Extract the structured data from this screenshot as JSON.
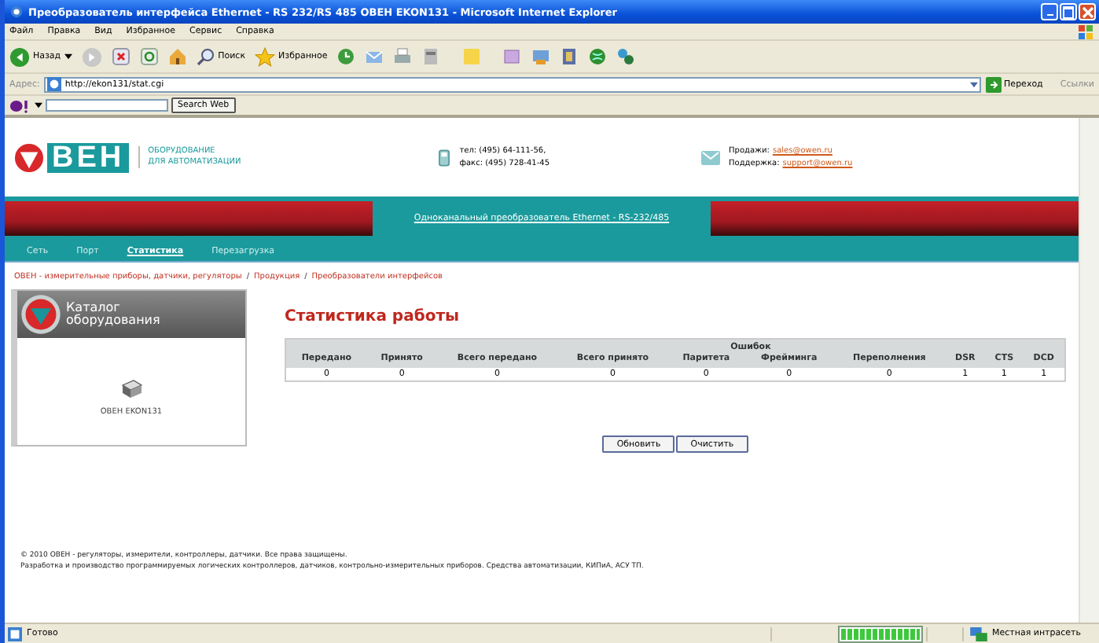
{
  "window": {
    "title": "Преобразователь интерфейса Ethernet - RS 232/RS 485 ОВЕН EKON131 - Microsoft Internet Explorer"
  },
  "menu": [
    "Файл",
    "Правка",
    "Вид",
    "Избранное",
    "Сервис",
    "Справка"
  ],
  "toolbar": {
    "back": "Назад",
    "search": "Поиск",
    "favorites": "Избранное"
  },
  "address": {
    "label": "Адрес:",
    "value": "http://ekon131/stat.cgi",
    "go": "Переход",
    "links": "Ссылки"
  },
  "search_bar": {
    "button": "Search Web"
  },
  "site": {
    "logo": "ВЕН",
    "tagline": [
      "ОБОРУДОВАНИЕ",
      "ДЛЯ АВТОМАТИЗАЦИИ"
    ],
    "phone": "тел: (495) 64-111-56,",
    "fax": "факс: (495) 728-41-45",
    "sales_label": "Продажи:",
    "sales_email": "sales@owen.ru",
    "support_label": "Поддержка:",
    "support_email": "support@owen.ru",
    "banner": "Одноканальный преобразователь Ethernet - RS-232/485",
    "nav": [
      {
        "label": "Сеть",
        "selected": false
      },
      {
        "label": "Порт",
        "selected": false
      },
      {
        "label": "Статистика",
        "selected": true
      },
      {
        "label": "Перезагрузка",
        "selected": false
      }
    ],
    "breadcrumb_separator": "/",
    "breadcrumb": [
      "ОВЕН - измерительные приборы, датчики, регуляторы",
      "Продукция",
      "Преобразователи интерфейсов"
    ],
    "catalog": {
      "title": [
        "Каталог",
        "оборудования"
      ],
      "device": "ОВЕН EKON131"
    },
    "heading": "Статистика работы",
    "header_rows": [
      [
        {
          "label": "Передано",
          "rowspan": 2
        },
        {
          "label": "Принято",
          "rowspan": 2
        },
        {
          "label": "Всего передано",
          "rowspan": 2
        },
        {
          "label": "Всего принято",
          "rowspan": 2
        },
        {
          "label": "Ошибок",
          "colspan": 2
        },
        {
          "label": "Переполнения",
          "rowspan": 2
        },
        {
          "label": "DSR",
          "rowspan": 2
        },
        {
          "label": "CTS",
          "rowspan": 2
        },
        {
          "label": "DCD",
          "rowspan": 2
        }
      ],
      [
        {
          "label": "Паритета"
        },
        {
          "label": "Фрейминга"
        }
      ]
    ],
    "rows": [
      [
        "0",
        "0",
        "0",
        "0",
        "0",
        "0",
        "0",
        "1",
        "1",
        "1"
      ]
    ],
    "buttons": [
      "Обновить",
      "Очистить"
    ],
    "footer": [
      "© 2010 ОВЕН - регуляторы, измерители, контроллеры, датчики. Все права защищены.",
      "Разработка и производство программируемых логических контроллеров, датчиков, контрольно-измерительных приборов. Средства автоматизации, КИПиА, АСУ ТП."
    ]
  },
  "status_bar": {
    "text": "Готово",
    "progress": {
      "level": 1
    },
    "zone": "Местная интрасеть"
  }
}
